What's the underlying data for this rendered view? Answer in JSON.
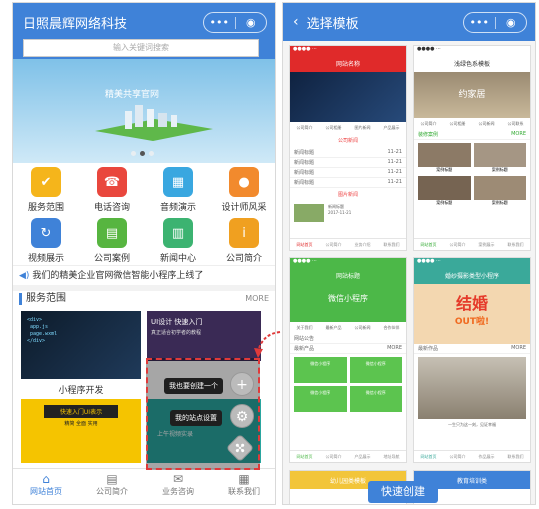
{
  "left": {
    "title": "日照晨辉网络科技",
    "search_placeholder": "输入关键词搜索",
    "banner_caption": "精美共享官网",
    "grid": [
      {
        "label": "服务范围",
        "icon": "folder-check-icon",
        "color": "#f5b51b"
      },
      {
        "label": "电话咨询",
        "icon": "phone-24-icon",
        "color": "#e9473d"
      },
      {
        "label": "音频演示",
        "icon": "cubes-icon",
        "color": "#39a7e0"
      },
      {
        "label": "设计师风采",
        "icon": "palette-icon",
        "color": "#f28a2d"
      },
      {
        "label": "视频展示",
        "icon": "refresh-icon",
        "color": "#3f82d8"
      },
      {
        "label": "公司案例",
        "icon": "document-icon",
        "color": "#57b540"
      },
      {
        "label": "新闻中心",
        "icon": "chart-icon",
        "color": "#3cb371"
      },
      {
        "label": "公司简介",
        "icon": "info-icon",
        "color": "#f0a020"
      }
    ],
    "notice": "我们的精美企业官网微信智能小程序上线了",
    "section_title": "服务范围",
    "section_more": "MORE",
    "card1_label": "小程序开发",
    "card2_text": "UI设计 快速入门",
    "card2_sub": "真正适合初学者的教程",
    "card3_text": "快速入门UI表示",
    "card3_sub": "精简 全面 实用",
    "card4_text": "上午视频实录",
    "overlay_create": "我也要创建一个",
    "overlay_settings": "我的站点设置",
    "tabs": [
      {
        "label": "网站首页",
        "icon": "home-icon"
      },
      {
        "label": "公司简介",
        "icon": "document-icon"
      },
      {
        "label": "业务咨询",
        "icon": "chat-icon"
      },
      {
        "label": "联系我们",
        "icon": "grid-icon"
      }
    ]
  },
  "right": {
    "title": "选择模板",
    "cta": "快速创建",
    "t1": {
      "title": "网站名称",
      "section1": "公司新闻",
      "section2": "图片新闻",
      "rows": [
        "新闻标题",
        "新闻标题",
        "新闻标题",
        "新闻标题"
      ],
      "date": "11-21",
      "icons": [
        "公司简介",
        "公司相册",
        "图片新闻",
        "产品展示"
      ],
      "tabs": [
        "网站首页",
        "公司简介",
        "业务介绍",
        "联系我们"
      ],
      "date2": "2017-11-21",
      "caption": "新闻标题"
    },
    "t2": {
      "title": "浅绿色系模板",
      "brand": "约家居",
      "icons": [
        "公司简介",
        "公司相册",
        "公司新闻",
        "公司联系"
      ],
      "section": "装修案例",
      "more": "MORE",
      "items": [
        "案例标题",
        "案例标题",
        "案例标题",
        "案例标题"
      ],
      "tabs": [
        "网站首页",
        "公司简介",
        "案例展示",
        "联系我们"
      ]
    },
    "t3": {
      "title": "网站标题",
      "banner": "微信小程序",
      "icons": [
        "关于我们",
        "最新产品",
        "公司新闻",
        "合作伙伴"
      ],
      "section": "最新产品",
      "more": "MORE",
      "items": [
        "微信小程序",
        "微信小程序",
        "微信小程序",
        "微信小程序"
      ],
      "notice": "网站公告",
      "tabs": [
        "网站首页",
        "公司简介",
        "产品展示",
        "地址导航"
      ]
    },
    "t4": {
      "title": "婚纱摄影类型小程序",
      "headline": "结婚",
      "sub": "OUT啦!",
      "section": "最新作品",
      "more": "MORE",
      "caption": "一生只为这一刻，见证幸福",
      "tabs": [
        "网站首页",
        "公司简介",
        "作品展示",
        "联系我们"
      ]
    },
    "t5": {
      "title": "幼儿园类模板"
    },
    "t6": {
      "title": "教育培训类"
    }
  }
}
